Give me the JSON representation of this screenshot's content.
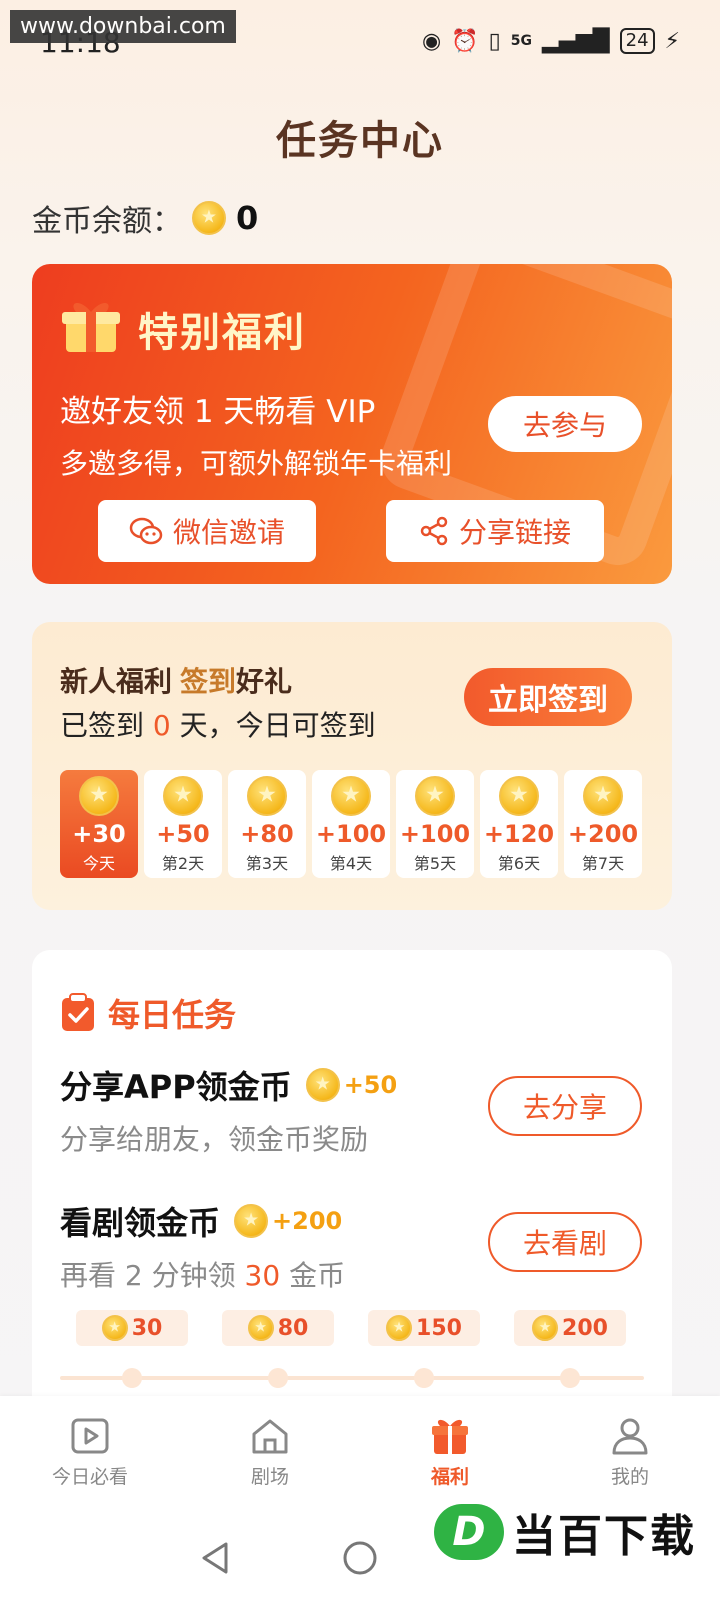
{
  "watermark": "www.downbai.com",
  "status": {
    "time": "11:18",
    "battery": "24",
    "network": "5G"
  },
  "page": {
    "title": "任务中心"
  },
  "balance": {
    "label": "金币余额：",
    "value": "0"
  },
  "special": {
    "title": "特别福利",
    "line1": "邀好友领 1 天畅看 VIP",
    "line2": "多邀多得，可额外解锁年卡福利",
    "join_label": "去参与",
    "wechat_label": "微信邀请",
    "share_label": "分享链接"
  },
  "signin": {
    "title": "新人福利",
    "title_hl": "签到",
    "title_hl2": "好礼",
    "sub_prefix": "已签到 ",
    "sub_days": "0",
    "sub_suffix": " 天，今日可签到",
    "button": "立即签到",
    "days": [
      {
        "amount": "+30",
        "label": "今天"
      },
      {
        "amount": "+50",
        "label": "第2天"
      },
      {
        "amount": "+80",
        "label": "第3天"
      },
      {
        "amount": "+100",
        "label": "第4天"
      },
      {
        "amount": "+100",
        "label": "第5天"
      },
      {
        "amount": "+120",
        "label": "第6天"
      },
      {
        "amount": "+200",
        "label": "第7天"
      }
    ]
  },
  "daily": {
    "title": "每日任务",
    "tasks": [
      {
        "title": "分享APP领金币",
        "reward": "+50",
        "desc": "分享给朋友，领金币奖励",
        "button": "去分享"
      },
      {
        "title": "看剧领金币",
        "reward": "+200",
        "desc_prefix": "再看 2 分钟领 ",
        "desc_num": "30",
        "desc_suffix": " 金币",
        "button": "去看剧"
      }
    ],
    "milestones": [
      "30",
      "80",
      "150",
      "200"
    ]
  },
  "tabs": [
    {
      "label": "今日必看",
      "icon": "play-icon"
    },
    {
      "label": "剧场",
      "icon": "house-icon"
    },
    {
      "label": "福利",
      "icon": "gift-icon"
    },
    {
      "label": "我的",
      "icon": "user-icon"
    }
  ],
  "logo": {
    "mark": "D",
    "text": "当百下载"
  },
  "colors": {
    "accent": "#ef5a2a",
    "card_gradient_start": "#ee3d1f",
    "card_gradient_end": "#fa9a3e",
    "coin": "#f5b81c"
  }
}
